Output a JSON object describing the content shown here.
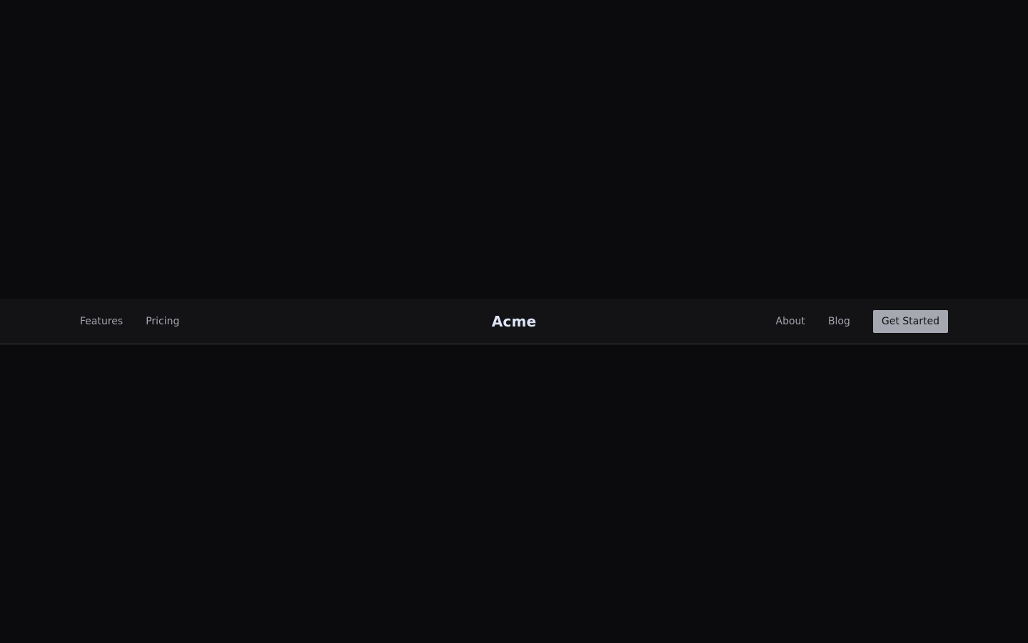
{
  "navbar": {
    "left_links": [
      {
        "label": "Features"
      },
      {
        "label": "Pricing"
      }
    ],
    "brand": "Acme",
    "right_links": [
      {
        "label": "About"
      },
      {
        "label": "Blog"
      }
    ],
    "cta_label": "Get Started"
  },
  "colors": {
    "page_background": "#0b0b0d",
    "navbar_background": "#131316",
    "navbar_border": "#3a3a42",
    "link_text": "#a3a5ad",
    "brand_text": "#dde4f5",
    "cta_background": "#a6a8b1",
    "cta_text": "#111114"
  }
}
